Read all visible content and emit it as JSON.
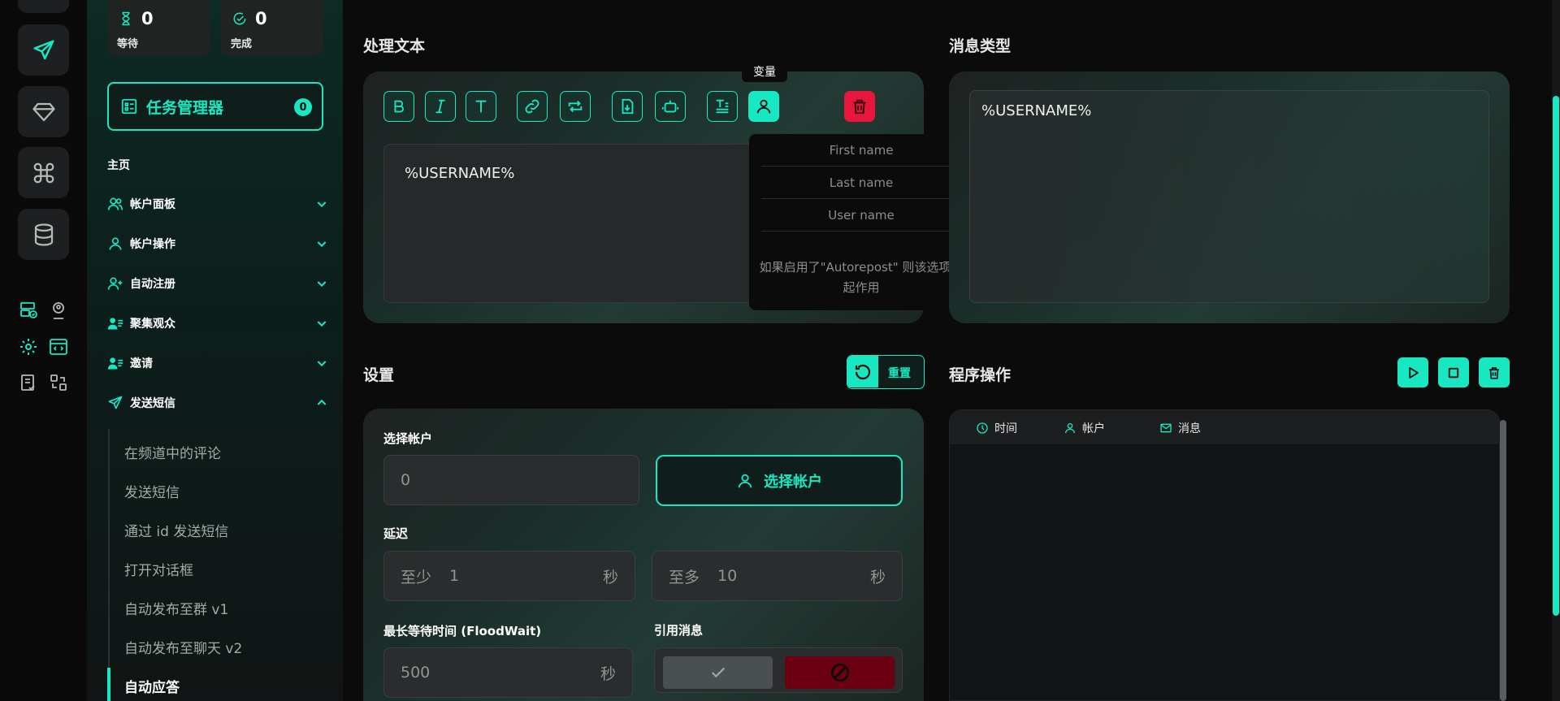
{
  "colors": {
    "accent": "#18e8c2",
    "danger": "#e8163c",
    "background": "#0b0b0c"
  },
  "rail": {
    "icons": [
      "send-icon",
      "diamond-icon",
      "command-icon",
      "database-icon",
      "server-check-icon",
      "user-pin-icon",
      "gear-icon",
      "code-window-icon",
      "checklist-icon",
      "transfer-icon"
    ]
  },
  "sidebar": {
    "stats": [
      {
        "value": "0",
        "label": "等待"
      },
      {
        "value": "0",
        "label": "完成"
      }
    ],
    "task_manager": {
      "label": "任务管理器",
      "count": "0"
    },
    "home": "主页",
    "nav": [
      {
        "label": "帐户面板"
      },
      {
        "label": "帐户操作"
      },
      {
        "label": "自动注册"
      },
      {
        "label": "聚集观众"
      },
      {
        "label": "邀请"
      },
      {
        "label": "发送短信"
      }
    ],
    "sub": [
      {
        "label": "在频道中的评论"
      },
      {
        "label": "发送短信"
      },
      {
        "label": "通过 id 发送短信"
      },
      {
        "label": "打开对话框"
      },
      {
        "label": "自动发布至群 v1"
      },
      {
        "label": "自动发布至聊天 v2"
      },
      {
        "label": "自动应答"
      }
    ]
  },
  "text_section": {
    "title": "处理文本",
    "content": "%USERNAME%",
    "tooltip": "变量",
    "variables": [
      "First name",
      "Last name",
      "User name"
    ],
    "note": "如果启用了\"Autorepost\" 则该选项不起作用"
  },
  "message_type": {
    "title": "消息类型",
    "content": "%USERNAME%"
  },
  "settings": {
    "title": "设置",
    "reset_label": "重置",
    "select_account_label": "选择帐户",
    "account_count": "0",
    "select_account_button": "选择帐户",
    "delay_label": "延迟",
    "delay_min_prefix": "至少",
    "delay_min": "1",
    "delay_max_prefix": "至多",
    "delay_max": "10",
    "unit_seconds": "秒",
    "floodwait_label": "最长等待时间 (FloodWait)",
    "floodwait_value": "500",
    "quote_label": "引用消息"
  },
  "program": {
    "title": "程序操作",
    "columns": [
      "时间",
      "帐户",
      "消息"
    ]
  }
}
